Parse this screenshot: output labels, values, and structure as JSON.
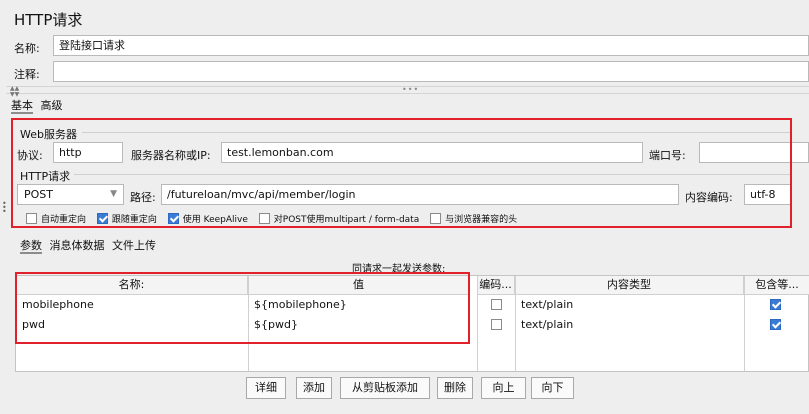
{
  "panel": {
    "title": "HTTP请求"
  },
  "name_field": {
    "label": "名称:",
    "value": "登陆接口请求"
  },
  "comment_field": {
    "label": "注释:",
    "value": ""
  },
  "divider": {
    "dots": "•••"
  },
  "top_tabs": [
    {
      "label": "基本"
    },
    {
      "label": "高级"
    }
  ],
  "web_server": {
    "legend": "Web服务器",
    "protocol_label": "协议:",
    "protocol_value": "http",
    "server_label": "服务器名称或IP:",
    "server_value": "test.lemonban.com",
    "port_label": "端口号:",
    "port_value": ""
  },
  "http_request": {
    "legend": "HTTP请求",
    "method": "POST",
    "path_label": "路径:",
    "path_value": "/futureloan/mvc/api/member/login",
    "encoding_label": "内容编码:",
    "encoding_value": "utf-8",
    "options": [
      {
        "label": "自动重定向",
        "checked": false
      },
      {
        "label": "跟随重定向",
        "checked": true
      },
      {
        "label": "使用 KeepAlive",
        "checked": true
      },
      {
        "label": "对POST使用multipart / form-data",
        "checked": false
      },
      {
        "label": "与浏览器兼容的头",
        "checked": false
      }
    ]
  },
  "sub_tabs": [
    {
      "label": "参数"
    },
    {
      "label": "消息体数据"
    },
    {
      "label": "文件上传"
    }
  ],
  "params": {
    "caption": "同请求一起发送参数:",
    "columns": [
      "名称:",
      "值",
      "编码...",
      "内容类型",
      "包含等..."
    ],
    "rows": [
      {
        "name": "mobilephone",
        "value": "${mobilephone}",
        "encode": false,
        "content_type": "text/plain",
        "include_equals": true
      },
      {
        "name": "pwd",
        "value": "${pwd}",
        "encode": false,
        "content_type": "text/plain",
        "include_equals": true
      }
    ]
  },
  "buttons": [
    {
      "label": "详细"
    },
    {
      "label": "添加"
    },
    {
      "label": "从剪贴板添加"
    },
    {
      "label": "删除"
    },
    {
      "label": "向上"
    },
    {
      "label": "向下"
    }
  ],
  "colors": {
    "highlight": "#e0202a",
    "checkbox": "#3a7bd5"
  },
  "icons": {
    "method_dropdown": "chevron-down-icon",
    "split_arrows": "collapse-arrows-icon"
  }
}
